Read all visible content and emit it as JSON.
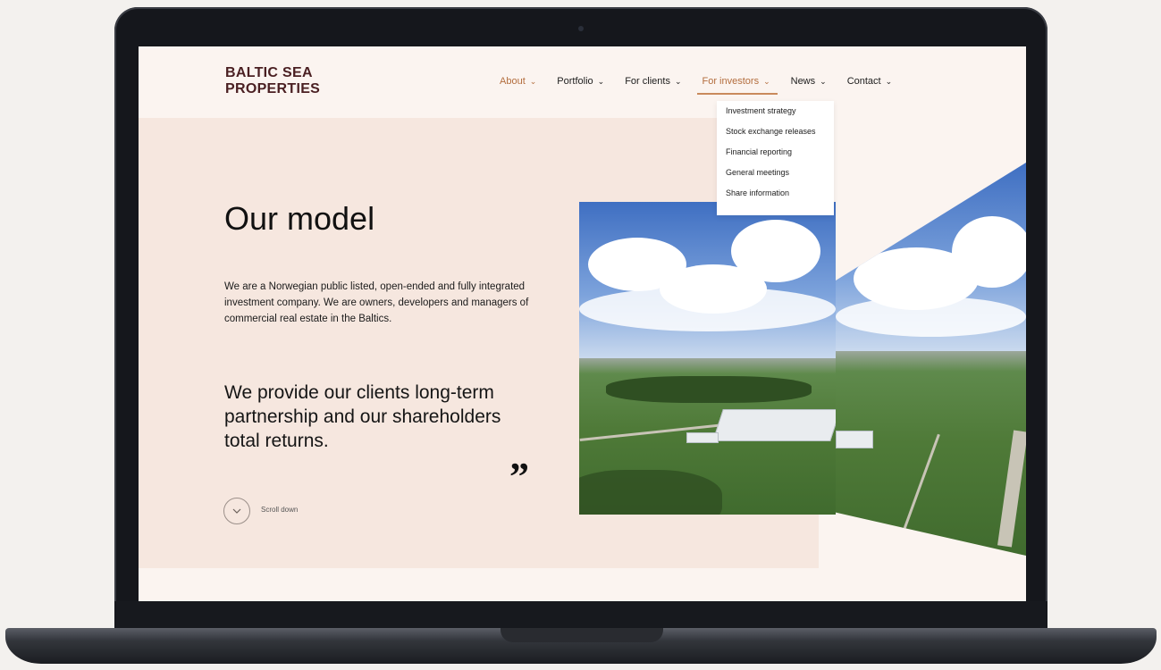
{
  "site": {
    "logo_line1": "BALTIC SEA",
    "logo_line2": "PROPERTIES"
  },
  "nav": {
    "items": [
      {
        "label": "About"
      },
      {
        "label": "Portfolio"
      },
      {
        "label": "For clients"
      },
      {
        "label": "For investors"
      },
      {
        "label": "News"
      },
      {
        "label": "Contact"
      }
    ],
    "chevron": "⌄"
  },
  "dropdown": {
    "items": [
      "Investment strategy",
      "Stock exchange releases",
      "Financial reporting",
      "General meetings",
      "Share information"
    ]
  },
  "hero": {
    "title": "Our model",
    "intro": "We are a Norwegian public listed, open-ended and fully integrated investment company. We are owners, developers and managers of commercial real estate in the Baltics.",
    "quote": "We provide our clients long-term partnership and our shareholders total returns.",
    "quote_mark": "”",
    "scroll_label": "Scroll down"
  },
  "colors": {
    "accent": "#b36d3d",
    "brand": "#4a1f22",
    "hero_bg": "#f6e7df",
    "page_bg": "#fbf4f0"
  },
  "icons": {
    "nav_chevron": "chevron-down-icon",
    "scroll": "chevron-down-icon"
  }
}
